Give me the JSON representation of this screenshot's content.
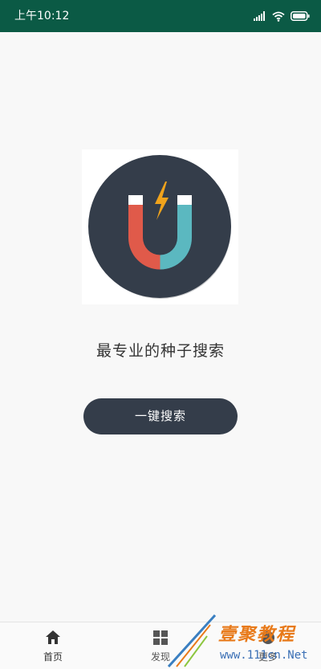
{
  "status_bar": {
    "time": "上午10:12",
    "icons": [
      "signal-icon",
      "wifi-icon",
      "battery-icon"
    ]
  },
  "main": {
    "logo": "magnet-bolt-logo",
    "slogan": "最专业的种子搜索",
    "search_button_label": "一键搜索"
  },
  "bottom_nav": {
    "items": [
      {
        "label": "首页",
        "icon": "home-icon",
        "active": true
      },
      {
        "label": "发现",
        "icon": "grid-icon",
        "active": false
      },
      {
        "label": "更多",
        "icon": "more-icon",
        "active": false
      }
    ]
  },
  "watermark": {
    "text": "壹聚教程",
    "url": "www.111cn.Net"
  },
  "colors": {
    "status_bar": "#0b5a45",
    "button": "#343d4a",
    "magnet_red": "#e05a4a",
    "magnet_teal": "#5bb8c0",
    "bolt": "#f0a31c"
  }
}
